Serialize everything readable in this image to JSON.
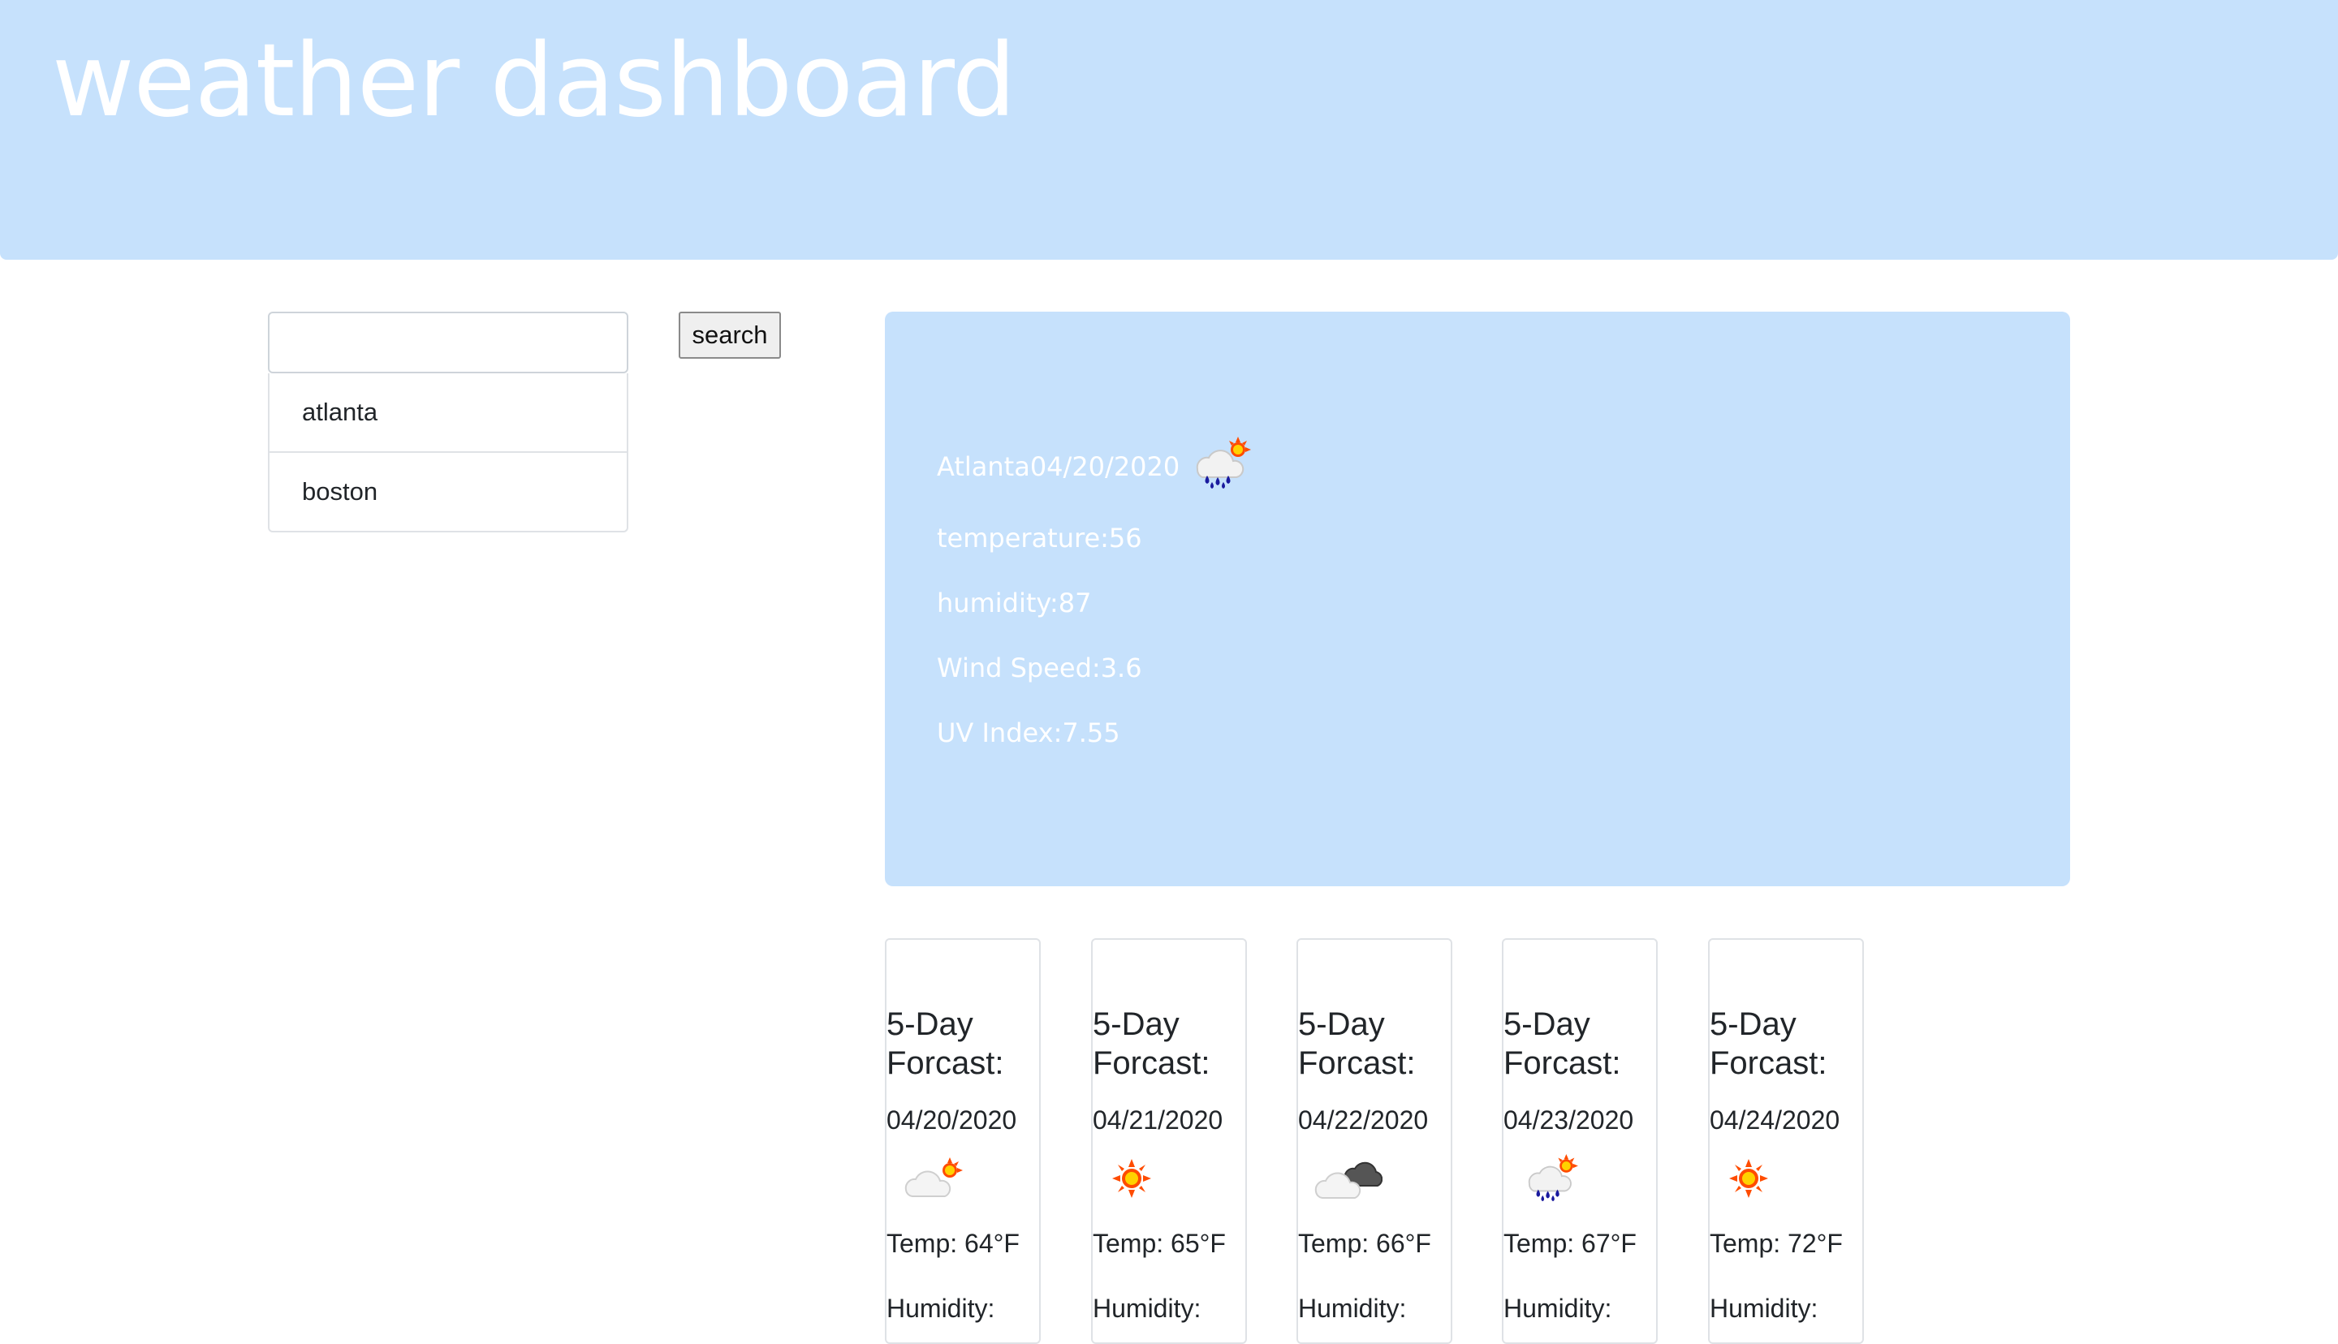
{
  "header": {
    "title": "weather dashboard"
  },
  "search": {
    "value": "",
    "placeholder": "",
    "button_label": "search"
  },
  "history": [
    "atlanta",
    "boston"
  ],
  "current": {
    "city": "Atlanta",
    "date": "04/20/2020",
    "icon": "rain-sun-icon",
    "temperature": "temperature:56",
    "humidity": "humidity:87",
    "wind": "Wind Speed:3.6",
    "uv": "UV Index:7.55"
  },
  "forecast": [
    {
      "title": "5-Day Forcast:",
      "date": "04/20/2020",
      "icon": "cloud-sun-icon",
      "temp": "Temp: 64°F",
      "humidity": "Humidity:"
    },
    {
      "title": "5-Day Forcast:",
      "date": "04/21/2020",
      "icon": "sun-icon",
      "temp": "Temp: 65°F",
      "humidity": "Humidity:"
    },
    {
      "title": "5-Day Forcast:",
      "date": "04/22/2020",
      "icon": "clouds-icon",
      "temp": "Temp: 66°F",
      "humidity": "Humidity:"
    },
    {
      "title": "5-Day Forcast:",
      "date": "04/23/2020",
      "icon": "rain-sun-icon",
      "temp": "Temp: 67°F",
      "humidity": "Humidity:"
    },
    {
      "title": "5-Day Forcast:",
      "date": "04/24/2020",
      "icon": "sun-icon",
      "temp": "Temp: 72°F",
      "humidity": "Humidity:"
    }
  ],
  "colors": {
    "accent": "#c6e1fc",
    "text_light": "#ffffff",
    "text_dark": "#212529"
  }
}
